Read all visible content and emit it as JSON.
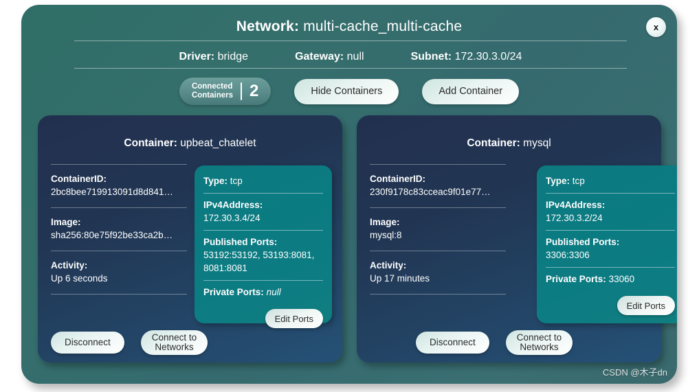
{
  "header": {
    "title_label": "Network:",
    "title_value": "multi-cache_multi-cache",
    "close_label": "x",
    "driver_label": "Driver:",
    "driver_value": "bridge",
    "gateway_label": "Gateway:",
    "gateway_value": "null",
    "subnet_label": "Subnet:",
    "subnet_value": "172.30.3.0/24"
  },
  "actions": {
    "connected_containers_label": "Connected\nContainers",
    "connected_containers_count": "2",
    "hide_containers_label": "Hide Containers",
    "add_container_label": "Add Container"
  },
  "containers": [
    {
      "title_label": "Container:",
      "title_value": "upbeat_chatelet",
      "info": {
        "container_id_key": "ContainerID:",
        "container_id_value": "2bc8bee719913091d8d841…",
        "image_key": "Image:",
        "image_value": "sha256:80e75f92be33ca2b…",
        "activity_key": "Activity:",
        "activity_value": "Up 6 seconds"
      },
      "ports": {
        "type_key": "Type:",
        "type_value": "tcp",
        "ipv4_key": "IPv4Address:",
        "ipv4_value": "172.30.3.4/24",
        "published_key": "Published Ports:",
        "published_value": "53192:53192, 53193:8081, 8081:8081",
        "private_key": "Private Ports:",
        "private_value": "null",
        "private_is_italic": true,
        "edit_ports_label": "Edit Ports"
      },
      "footer": {
        "disconnect_label": "Disconnect",
        "connect_networks_label": "Connect to\nNetworks"
      }
    },
    {
      "title_label": "Container:",
      "title_value": "mysql",
      "info": {
        "container_id_key": "ContainerID:",
        "container_id_value": "230f9178c83cceac9f01e77…",
        "image_key": "Image:",
        "image_value": "mysql:8",
        "activity_key": "Activity:",
        "activity_value": "Up 17 minutes"
      },
      "ports": {
        "type_key": "Type:",
        "type_value": "tcp",
        "ipv4_key": "IPv4Address:",
        "ipv4_value": "172.30.3.2/24",
        "published_key": "Published Ports:",
        "published_value": "3306:3306",
        "private_key": "Private Ports:",
        "private_value": "33060",
        "private_is_italic": false,
        "edit_ports_label": "Edit Ports"
      },
      "footer": {
        "disconnect_label": "Disconnect",
        "connect_networks_label": "Connect to\nNetworks"
      }
    }
  ],
  "watermark": {
    "text": "CSDN @木子dn"
  },
  "colors": {
    "modal_bg": "#356c6e",
    "card_bg": "#22304f",
    "ports_panel": "#0d7a80",
    "accent_pill": "#5b8e8c",
    "button_light": "#eaf5f3",
    "text_primary": "#ffffff"
  }
}
